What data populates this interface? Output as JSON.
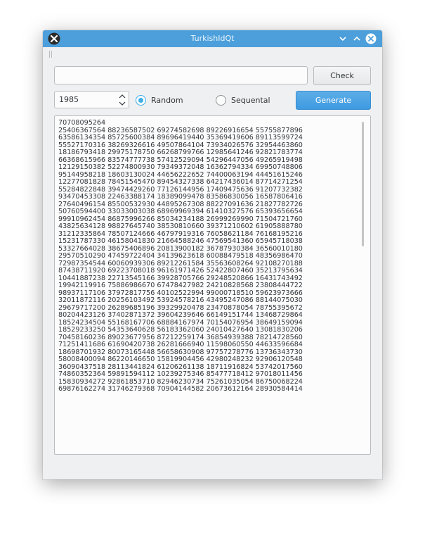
{
  "window": {
    "title": "TurkishIdQt",
    "accent": "#4c9fdb"
  },
  "icons": {
    "app": "app-icon",
    "minimize": "chevron-down-icon",
    "maximize": "chevron-up-icon",
    "close": "close-icon"
  },
  "id_input": {
    "value": "",
    "placeholder": ""
  },
  "check_button": "Check",
  "year_spinbox": {
    "value": "1985"
  },
  "mode": {
    "random_label": "Random",
    "sequental_label": "Sequental",
    "selected": "Random"
  },
  "generate_button": "Generate",
  "output": {
    "lines": [
      "70708095264",
      "25406367564 88236587502 69274582698 89226916654 55755877896",
      "63586134354 85725600384 89696419440 35369419606 89113599724",
      "55527170316 38269326616 49507864104 73934026576 32954463860",
      "18186793418 29975178750 66268799766 12985641246 92821783774",
      "66368615966 83574777738 57412529094 54296447056 49265919498",
      "12129150382 52274800930 79349372048 16362794334 69950748806",
      "95144958218 18603130024 44656222652 74400063194 44451615246",
      "12277081828 78451545470 89454327338 64217436014 87714271254",
      "55284822848 39474429260 77126144956 17409475636 91207732382",
      "93470453308 22463388174 18389099478 83586830056 16587806416",
      "27640496154 85500532930 44895267308 88227091636 21827782726",
      "50760594400 33033003038 68969969394 61410327576 65393656654",
      "99910962454 86875996266 85034234188 26999269990 71504721760",
      "43825634128 98827645740 38530810660 39371210602 61905888780",
      "31212335864 78507124666 46797919316 76058621184 76168195216",
      "15231787330 46158041830 21664588246 47569541360 65945718038",
      "53327664028 38675406896 20813900182 36787930384 36560010180",
      "29570510290 47459722404 34139623618 60088479518 48356986470",
      "72987354544 60060939306 89212261584 35563608264 92108270188",
      "87438711920 69223708018 96161971426 52422807460 35213795634",
      "10441887238 22713545166 39928705766 29248520866 16431743492",
      "19942119916 75886986670 67478427982 24210828568 23808444722",
      "98937117106 37972817756 40102522994 99000718510 59623973666",
      "32011872116 20256103492 53924578216 43495247086 88144075030",
      "29679717200 26289685196 39329920478 23470878054 78755395672",
      "80204423126 37402871372 39604239646 66149151744 13468729864",
      "18524234504 55168167706 68884167974 70154076954 38649159094",
      "18529233250 54353640628 56183362060 24010427640 13081830206",
      "70458160236 89023677956 87212259174 36854939388 78214728560",
      "71251411686 61690420738 26281666940 11598060550 44633596684",
      "18698701932 80073165448 56658630908 97757278776 13736343730",
      "58008400094 86220146650 15819904456 42980248232 92906120548",
      "36090437518 28113441824 61206261138 18711916824 53742017560",
      "74860352364 59891594112 10239275346 85477718412 97018011456",
      "15830934272 92861853710 82946230734 75261035054 86750068224",
      "69876162274 31746279368 70904144582 20673612164 28930584414"
    ]
  }
}
